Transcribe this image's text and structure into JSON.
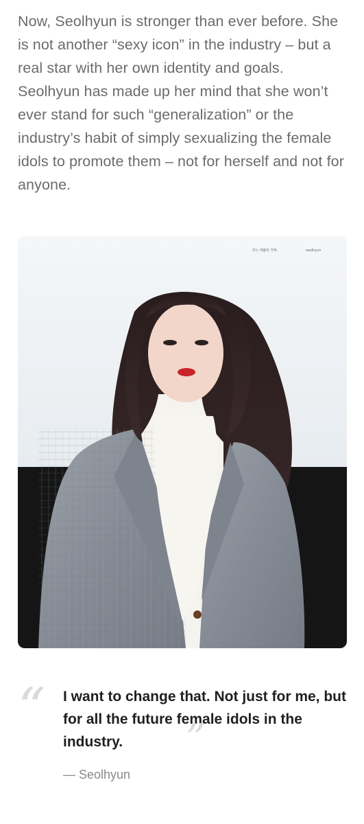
{
  "article": {
    "paragraph": "Now, Seolhyun is stronger than ever before. She is not another “sexy icon” in the industry – but a real star with her own identity and goals. Seolhyun has made up her mind that she won’t ever stand for such “generalization” or the industry’s habit of simply sexualizing the female idols to promote them – not for herself and not for anyone.",
    "photo": {
      "icon": "photo-image",
      "subject": "seolhyun-portrait"
    },
    "quote": {
      "open_mark": "“",
      "close_mark": "”",
      "text": "I want to change that. Not just for me, but for all the future female idols in the industry.",
      "author": "— Seolhyun"
    }
  },
  "colors": {
    "body_text": "#6b6b6b",
    "quote_text": "#1f1f1f",
    "quote_mark": "#d9d9d9",
    "author_text": "#8a8a8a"
  }
}
